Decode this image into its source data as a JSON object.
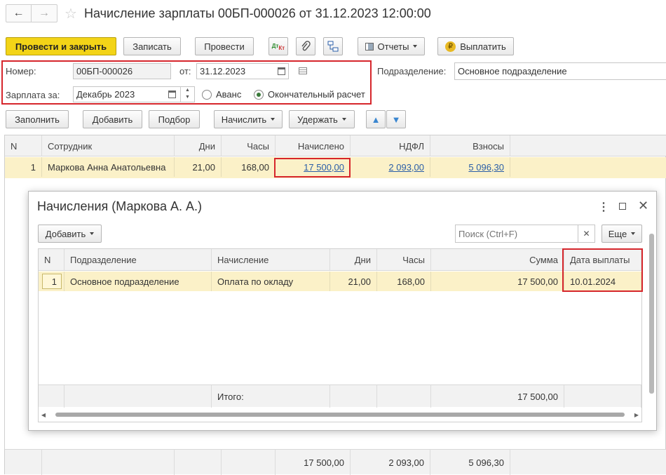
{
  "window": {
    "title": "Начисление зарплаты 00БП-000026 от 31.12.2023 12:00:00"
  },
  "toolbar": {
    "post_close": "Провести и закрыть",
    "save": "Записать",
    "post": "Провести",
    "reports": "Отчеты",
    "pay": "Выплатить"
  },
  "header": {
    "number_label": "Номер:",
    "number_value": "00БП-000026",
    "date_label": "от:",
    "date_value": "31.12.2023",
    "division_label": "Подразделение:",
    "division_value": "Основное подразделение",
    "salary_for_label": "Зарплата за:",
    "salary_for_value": "Декабрь 2023",
    "radio_advance": "Аванс",
    "radio_final": "Окончательный расчет"
  },
  "actions": {
    "fill": "Заполнить",
    "add": "Добавить",
    "select": "Подбор",
    "accrue": "Начислить",
    "withhold": "Удержать"
  },
  "main_table": {
    "columns": [
      "N",
      "Сотрудник",
      "Дни",
      "Часы",
      "Начислено",
      "НДФЛ",
      "Взносы"
    ],
    "rows": [
      {
        "n": "1",
        "employee": "Маркова Анна Анатольевна",
        "days": "21,00",
        "hours": "168,00",
        "accrued": "17 500,00",
        "ndfl": "2 093,00",
        "contrib": "5 096,30"
      }
    ],
    "totals": {
      "accrued": "17 500,00",
      "ndfl": "2 093,00",
      "contrib": "5 096,30"
    }
  },
  "dialog": {
    "title": "Начисления (Маркова А. А.)",
    "add": "Добавить",
    "search_placeholder": "Поиск (Ctrl+F)",
    "more": "Еще",
    "columns": [
      "N",
      "Подразделение",
      "Начисление",
      "Дни",
      "Часы",
      "Сумма",
      "Дата выплаты"
    ],
    "rows": [
      {
        "n": "1",
        "division": "Основное подразделение",
        "accrual": "Оплата по окладу",
        "days": "21,00",
        "hours": "168,00",
        "sum": "17 500,00",
        "pay_date": "10.01.2024"
      }
    ],
    "total_label": "Итого:",
    "total_sum": "17 500,00"
  },
  "colors": {
    "accent": "#f3d417",
    "highlight": "#d6262c",
    "selected_row": "#fbf1c8"
  }
}
